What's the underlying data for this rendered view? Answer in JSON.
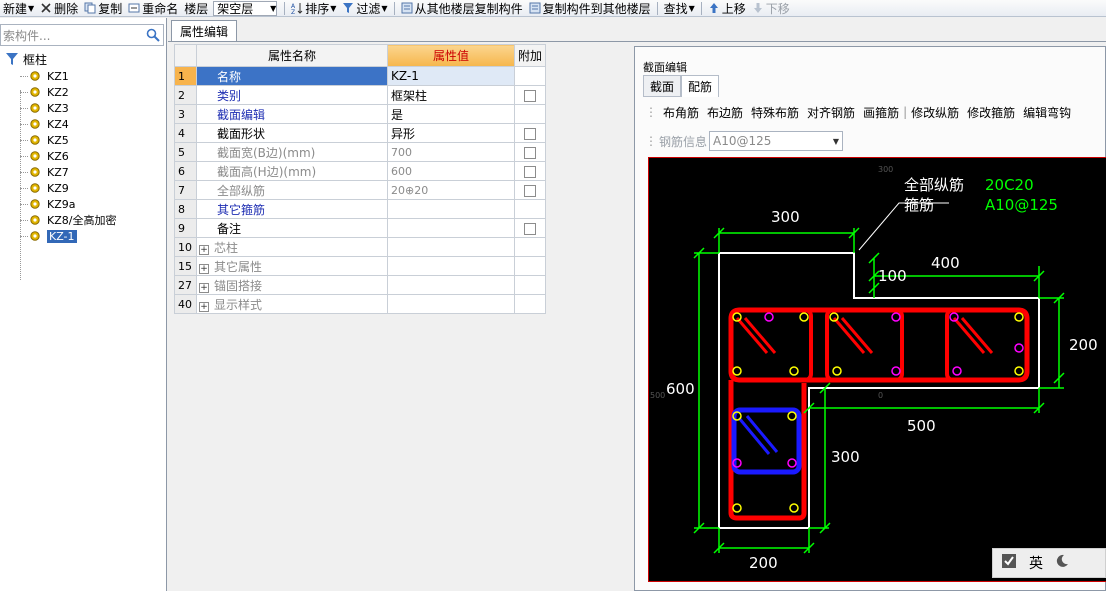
{
  "toolbar": {
    "new": "新建",
    "delete": "删除",
    "copy": "复制",
    "rename": "重命名",
    "floor_label": "楼层",
    "floor_value": "架空层",
    "sort": "排序",
    "filter": "过滤",
    "copy_from": "从其他楼层复制构件",
    "copy_to": "复制构件到其他楼层",
    "find": "查找",
    "move_up": "上移",
    "move_down": "下移"
  },
  "search": {
    "placeholder": "索构件..."
  },
  "tree": {
    "root": "框柱",
    "items": [
      "KZ1",
      "KZ2",
      "KZ3",
      "KZ4",
      "KZ5",
      "KZ6",
      "KZ7",
      "KZ9",
      "KZ9a",
      "KZ8/全高加密",
      "KZ-1"
    ],
    "selected": "KZ-1"
  },
  "props_tab": "属性编辑",
  "grid": {
    "headers": {
      "name": "属性名称",
      "value": "属性值",
      "extra": "附加"
    },
    "rows": [
      {
        "num": "1",
        "name": "名称",
        "value": "KZ-1"
      },
      {
        "num": "2",
        "name": "类别",
        "value": "框架柱"
      },
      {
        "num": "3",
        "name": "截面编辑",
        "value": "是"
      },
      {
        "num": "4",
        "name": "截面形状",
        "value": "异形"
      },
      {
        "num": "5",
        "name": "截面宽(B边)(mm)",
        "value": "700"
      },
      {
        "num": "6",
        "name": "截面高(H边)(mm)",
        "value": "600"
      },
      {
        "num": "7",
        "name": "全部纵筋",
        "value": "20⊕20"
      },
      {
        "num": "8",
        "name": "其它箍筋",
        "value": ""
      },
      {
        "num": "9",
        "name": "备注",
        "value": ""
      },
      {
        "num": "10",
        "name": "芯柱",
        "value": ""
      },
      {
        "num": "15",
        "name": "其它属性",
        "value": ""
      },
      {
        "num": "27",
        "name": "锚固搭接",
        "value": ""
      },
      {
        "num": "40",
        "name": "显示样式",
        "value": ""
      }
    ]
  },
  "section": {
    "title": "截面编辑",
    "tabs": [
      "截面",
      "配筋"
    ],
    "tools": [
      "布角筋",
      "布边筋",
      "特殊布筋",
      "对齐钢筋",
      "画箍筋",
      "修改纵筋",
      "修改箍筋",
      "编辑弯钩"
    ],
    "rebar_info_label": "钢筋信息",
    "rebar_info_value": "A10@125",
    "canvas": {
      "label_longitudinal": "全部纵筋",
      "label_stirrup": "箍筋",
      "value_longitudinal": "20C20",
      "value_stirrup": "A10@125",
      "dims": {
        "d300_top": "300",
        "d400": "400",
        "d100": "100",
        "d200_right": "200",
        "d600": "600",
        "d500": "500",
        "d300_mid": "300",
        "d200_bottom": "200"
      },
      "faint": {
        "top": "300",
        "left": "500",
        "center": "0"
      }
    }
  },
  "ime": {
    "lang": "英"
  },
  "colors": {
    "canvas_bg": "#000000",
    "outline": "#ffffff",
    "stirrup_red": "#ff0000",
    "stirrup_blue": "#1a1aff",
    "dim_green": "#00ff00",
    "rebar_yellow": "#ffff00",
    "rebar_magenta": "#ff00ff"
  }
}
